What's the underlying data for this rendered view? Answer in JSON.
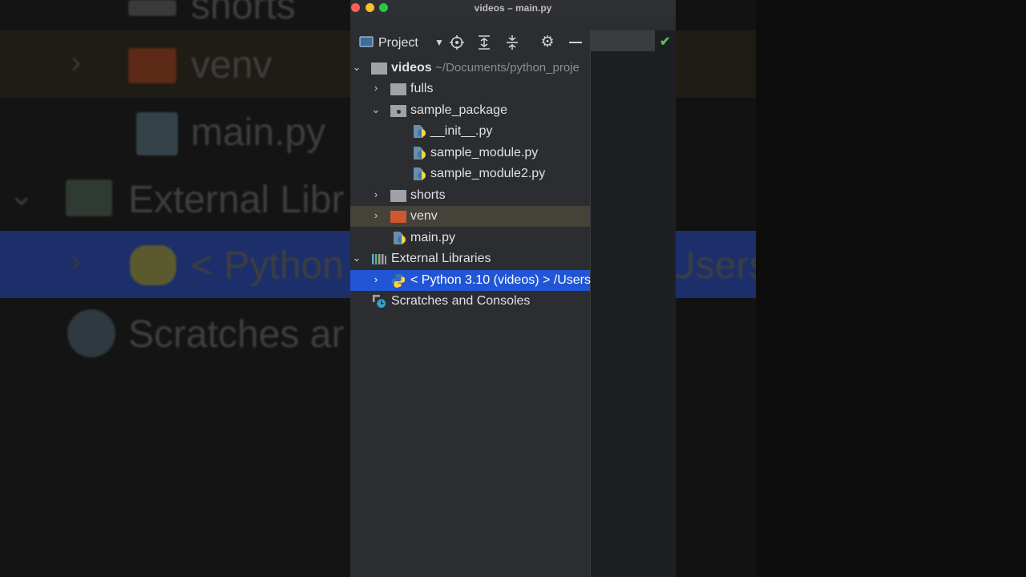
{
  "window": {
    "title": "videos – main.py"
  },
  "toolbar": {
    "project_label": "Project",
    "icons": [
      "project-view-icon",
      "dropdown-icon",
      "locate-icon",
      "expand-all-icon",
      "collapse-all-icon",
      "gear-icon",
      "hide-icon"
    ]
  },
  "tree": {
    "root": {
      "name": "videos",
      "path": "~/Documents/python_proje"
    },
    "items": [
      {
        "label": "fulls"
      },
      {
        "label": "sample_package"
      },
      {
        "label": "__init__.py"
      },
      {
        "label": "sample_module.py"
      },
      {
        "label": "sample_module2.py"
      },
      {
        "label": "shorts"
      },
      {
        "label": "venv"
      },
      {
        "label": "main.py"
      },
      {
        "label": "External Libraries"
      },
      {
        "label": "< Python 3.10 (videos) > /Users"
      },
      {
        "label": "Scratches and Consoles"
      }
    ]
  },
  "background": {
    "shorts": "shorts",
    "venv": "venv",
    "main": "main.py",
    "ext_lib": "External Libr",
    "python_left": "< Python",
    "python_right": "Users",
    "scratches": "Scratches ar"
  },
  "colors": {
    "selection": "#2155d6",
    "venv_folder": "#d0582f",
    "folder": "#9fa2a6",
    "check": "#5fb865"
  }
}
